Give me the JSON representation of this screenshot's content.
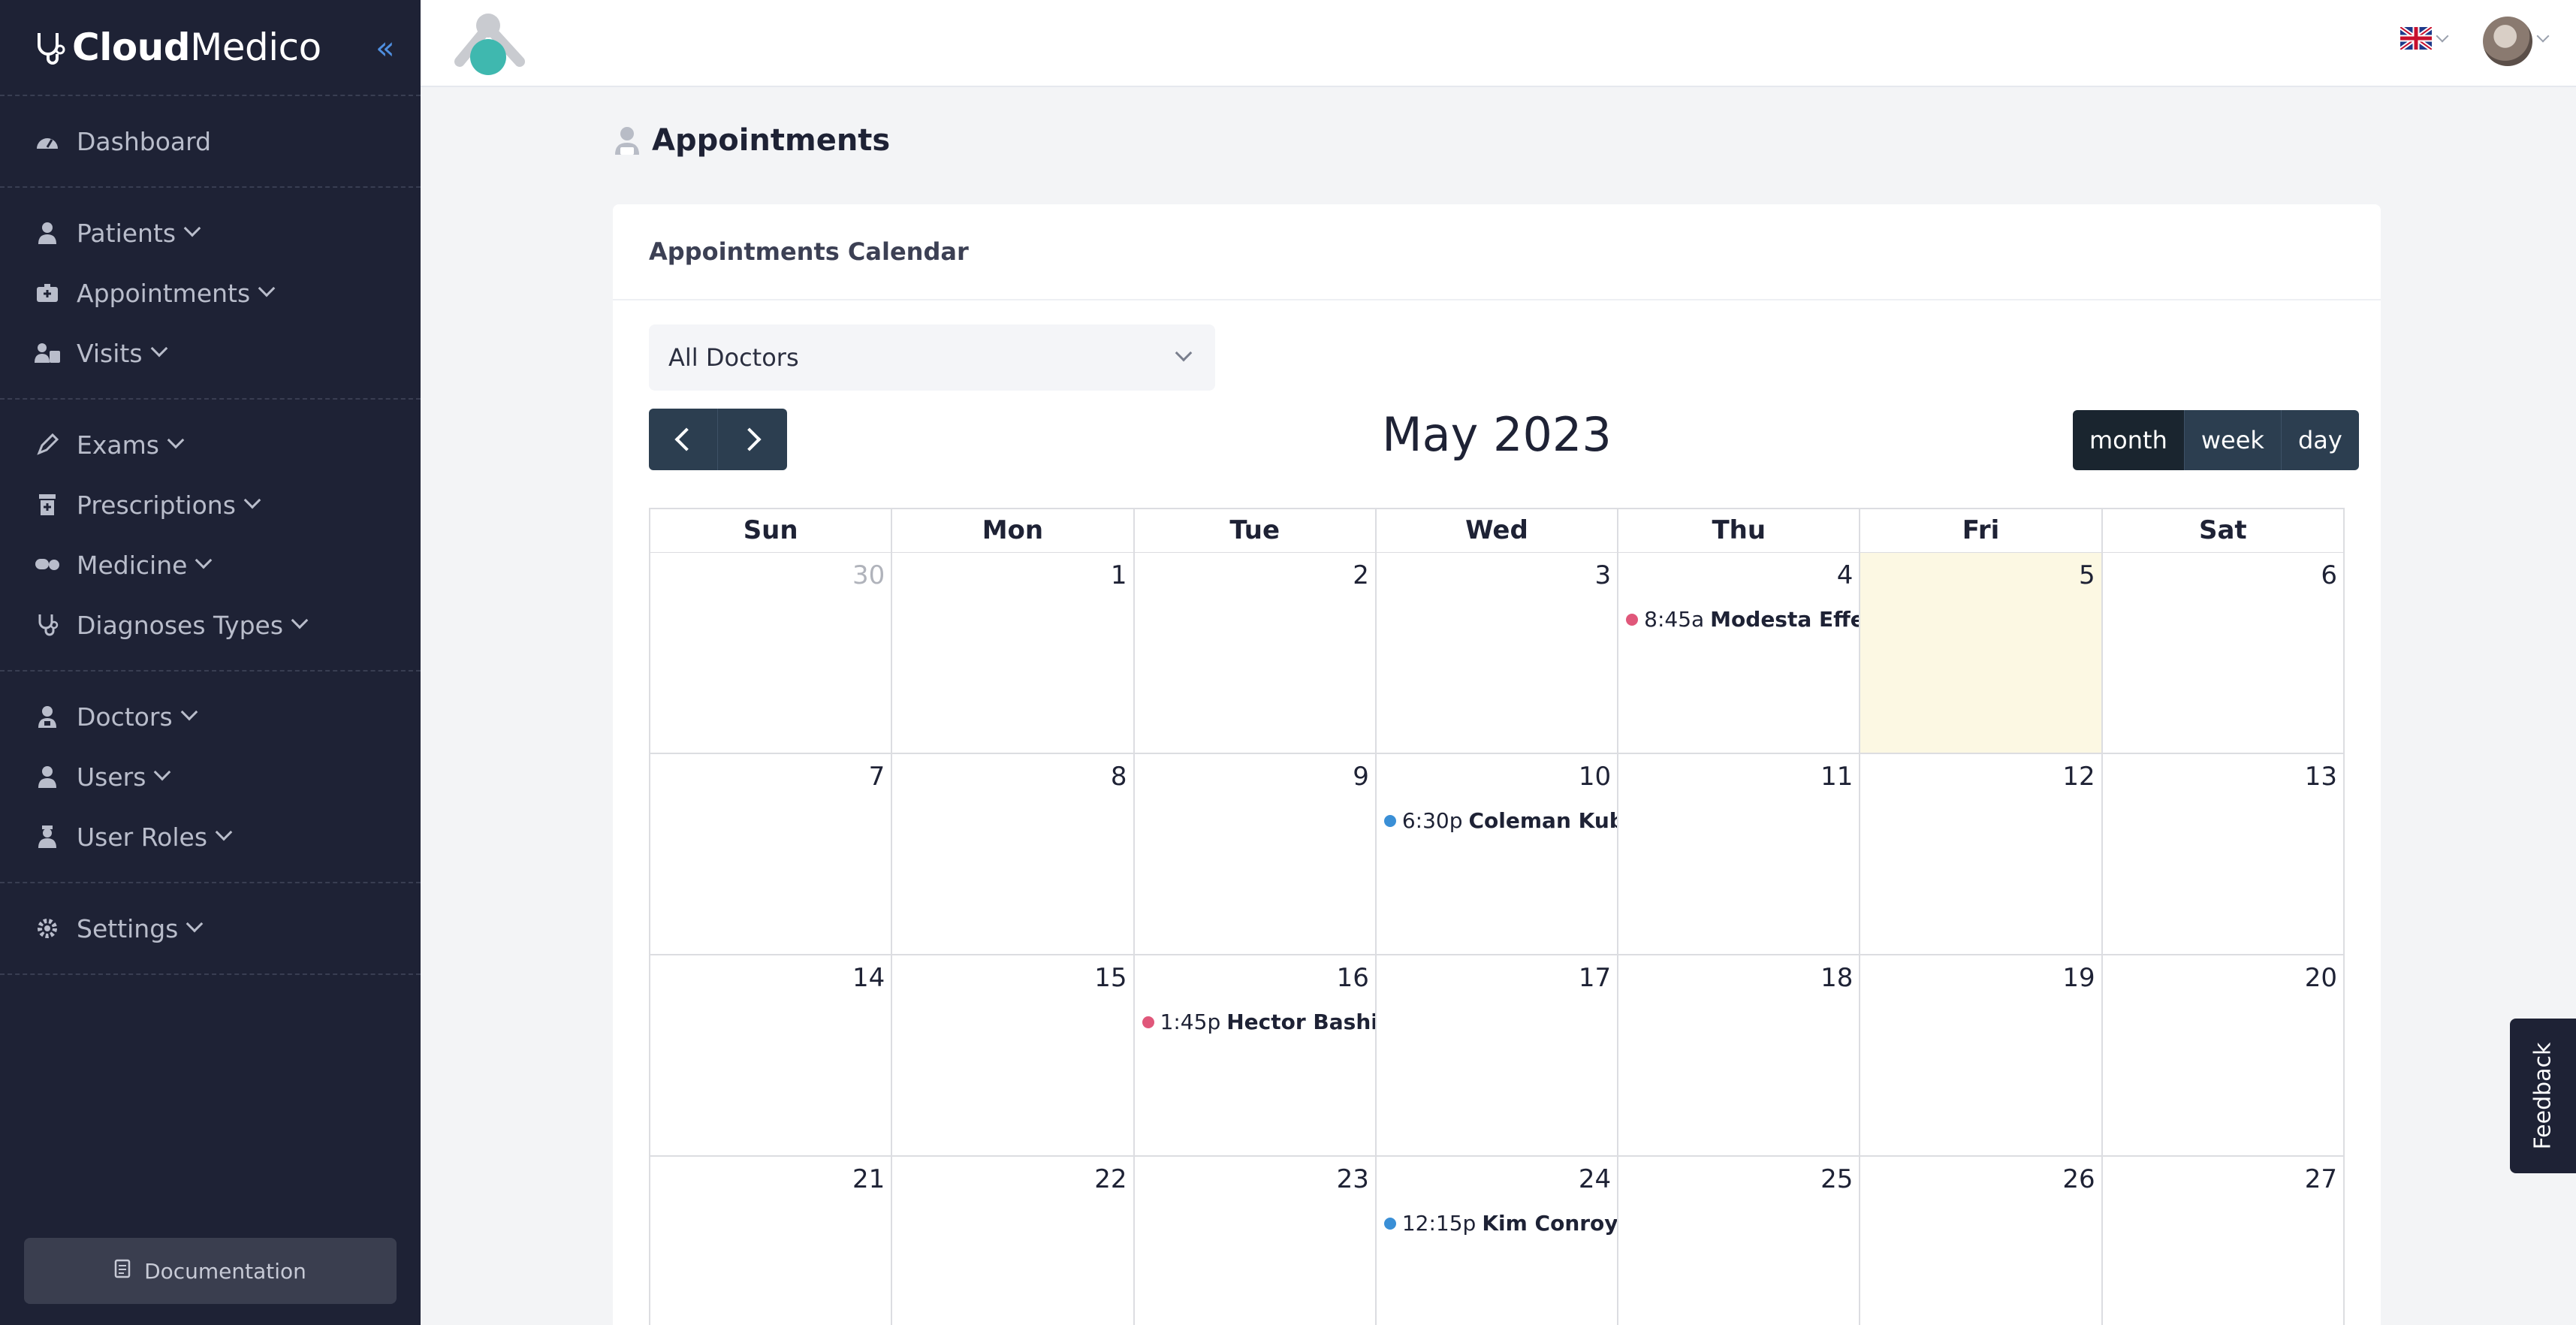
{
  "brand": {
    "bold": "Cloud",
    "light": "Medico"
  },
  "sidebar": {
    "groups": [
      [
        {
          "label": "Dashboard",
          "icon": "dashboard-icon",
          "chevron": false
        }
      ],
      [
        {
          "label": "Patients",
          "icon": "patient-icon",
          "chevron": true
        },
        {
          "label": "Appointments",
          "icon": "appointment-icon",
          "chevron": true
        },
        {
          "label": "Visits",
          "icon": "visits-icon",
          "chevron": true
        }
      ],
      [
        {
          "label": "Exams",
          "icon": "pencil-icon",
          "chevron": true
        },
        {
          "label": "Prescriptions",
          "icon": "prescription-icon",
          "chevron": true
        },
        {
          "label": "Medicine",
          "icon": "pills-icon",
          "chevron": true
        },
        {
          "label": "Diagnoses Types",
          "icon": "stethoscope-icon",
          "chevron": true
        }
      ],
      [
        {
          "label": "Doctors",
          "icon": "doctor-icon",
          "chevron": true
        },
        {
          "label": "Users",
          "icon": "user-icon",
          "chevron": true
        },
        {
          "label": "User Roles",
          "icon": "user-role-icon",
          "chevron": true
        }
      ],
      [
        {
          "label": "Settings",
          "icon": "gear-icon",
          "chevron": true
        }
      ]
    ],
    "documentation_label": "Documentation"
  },
  "page": {
    "title": "Appointments"
  },
  "card": {
    "title": "Appointments Calendar"
  },
  "filter": {
    "selected": "All Doctors"
  },
  "calendar": {
    "title": "May 2023",
    "views": [
      "month",
      "week",
      "day"
    ],
    "active_view": "month",
    "weekdays": [
      "Sun",
      "Mon",
      "Tue",
      "Wed",
      "Thu",
      "Fri",
      "Sat"
    ],
    "weeks": [
      [
        {
          "n": "30",
          "other": true
        },
        {
          "n": "1"
        },
        {
          "n": "2"
        },
        {
          "n": "3"
        },
        {
          "n": "4",
          "event": {
            "time": "8:45a",
            "title": "Modesta Effertz",
            "color": "#e0577a"
          }
        },
        {
          "n": "5",
          "today": true
        },
        {
          "n": "6"
        }
      ],
      [
        {
          "n": "7"
        },
        {
          "n": "8"
        },
        {
          "n": "9"
        },
        {
          "n": "10",
          "event": {
            "time": "6:30p",
            "title": "Coleman Kub L",
            "color": "#3a8fd6"
          }
        },
        {
          "n": "11"
        },
        {
          "n": "12"
        },
        {
          "n": "13"
        }
      ],
      [
        {
          "n": "14"
        },
        {
          "n": "15"
        },
        {
          "n": "16",
          "event": {
            "time": "1:45p",
            "title": "Hector Bashirian",
            "color": "#e0577a"
          }
        },
        {
          "n": "17"
        },
        {
          "n": "18"
        },
        {
          "n": "19"
        },
        {
          "n": "20"
        }
      ],
      [
        {
          "n": "21"
        },
        {
          "n": "22"
        },
        {
          "n": "23"
        },
        {
          "n": "24",
          "event": {
            "time": "12:15p",
            "title": "Kim Conroy Jr.",
            "color": "#3a8fd6"
          }
        },
        {
          "n": "25"
        },
        {
          "n": "26"
        },
        {
          "n": "27"
        }
      ]
    ]
  },
  "feedback_label": "Feedback",
  "colors": {
    "sidebar": "#1e2235",
    "accent": "#4f8fe0",
    "button": "#2c3e50",
    "today": "#fcf8e3"
  }
}
